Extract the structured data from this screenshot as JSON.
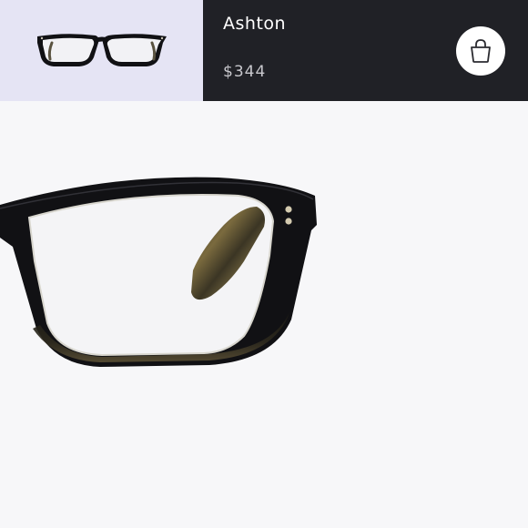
{
  "product": {
    "name": "Ashton",
    "price": "$344"
  },
  "colors": {
    "thumbnail_bg": "#e5e4f4",
    "header_bg": "#202126",
    "page_bg": "#f7f7f9",
    "frame": "#111114"
  },
  "icons": {
    "cart": "shopping-bag-icon"
  }
}
